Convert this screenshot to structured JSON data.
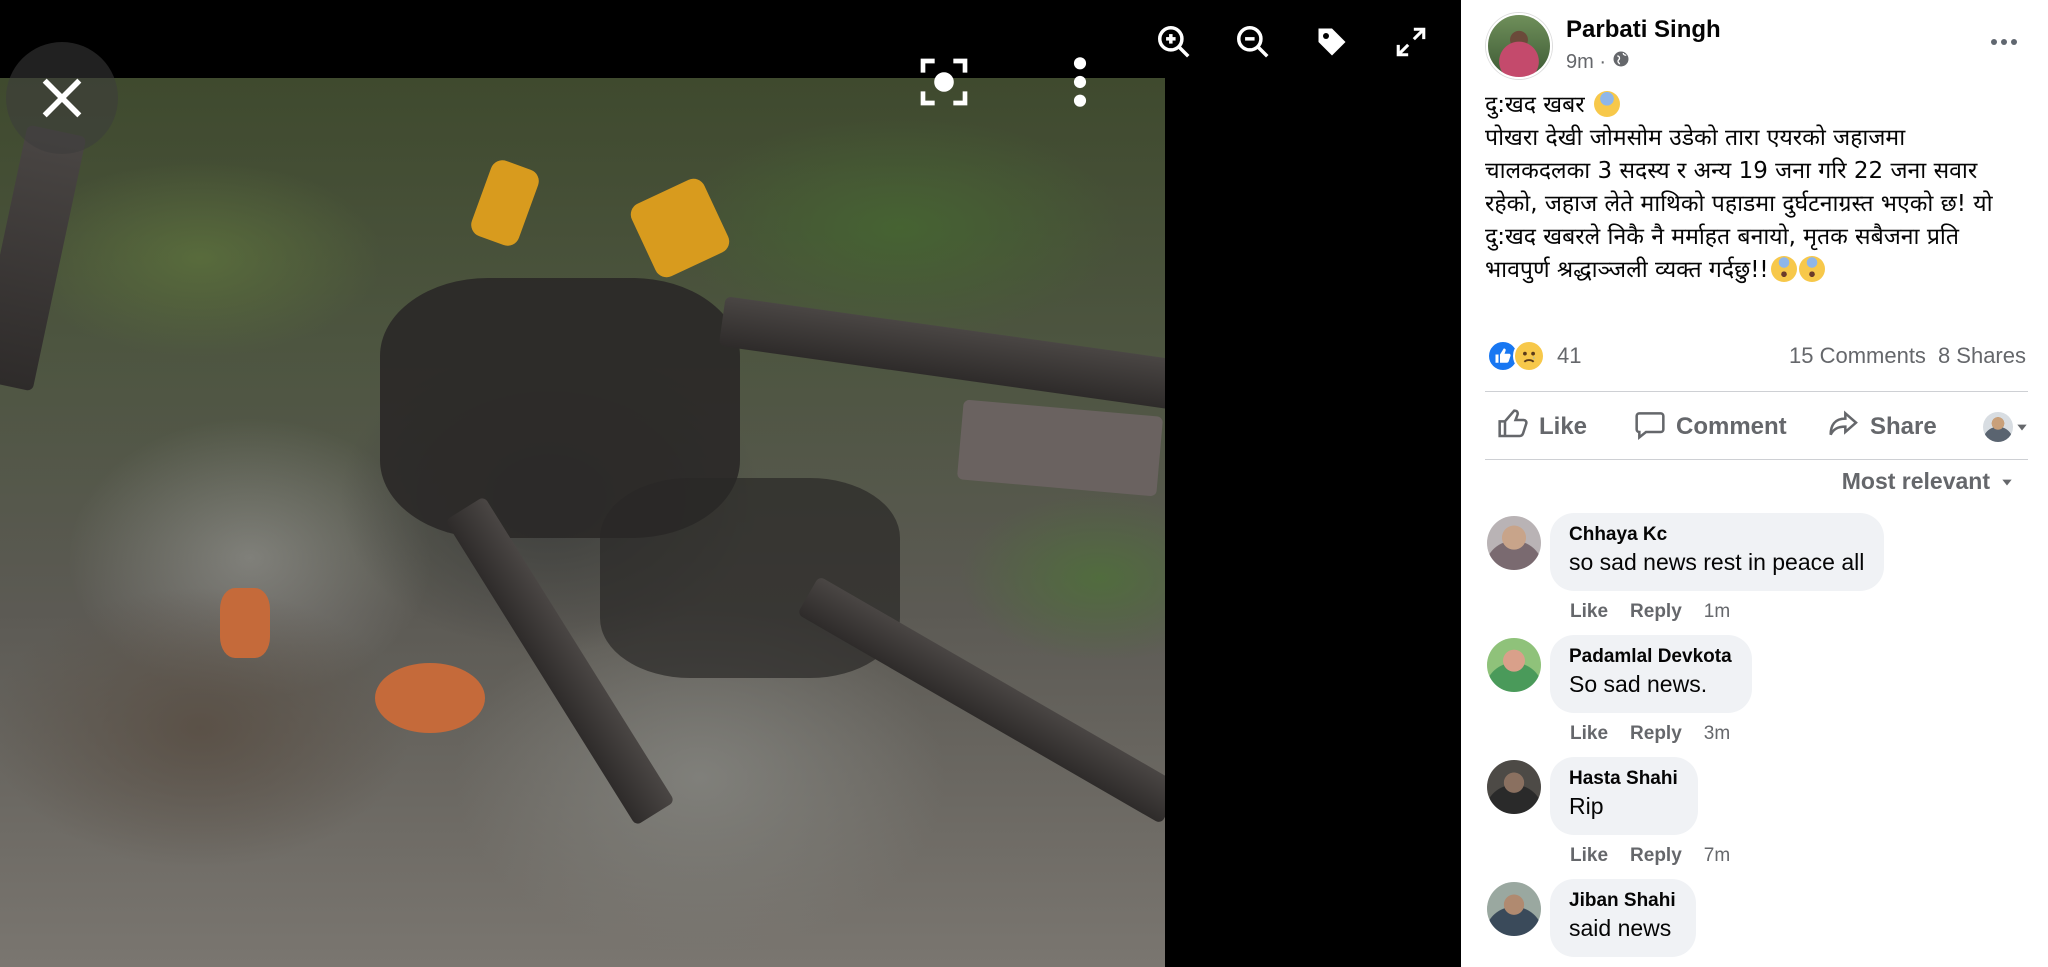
{
  "viewer": {
    "icons": [
      "zoom-in-icon",
      "zoom-out-icon",
      "tag-icon",
      "fullscreen-icon",
      "close-icon",
      "scan-icon",
      "more-vertical-icon"
    ]
  },
  "post": {
    "author": "Parbati Singh",
    "time": "9m ·",
    "lines": [
      "दु:खद खबर",
      "पोखरा देखी जोमसोम उडेको तारा एयरको जहाजमा",
      "चालकदलका 3 सदस्य र अन्य 19 जना गरि 22 जना सवार",
      "रहेको, जहाज लेते माथिको पहाडमा दुर्घटनाग्रस्त भएको छ! यो",
      "दु:खद खबरले निकै नै मर्माहत बनायो, मृतक सबैजना प्रति",
      "भावपुर्ण श्रद्धाञ्जली व्यक्त गर्दछु!!"
    ],
    "reaction_count": "41",
    "comments_count": "15 Comments",
    "shares_count": "8 Shares",
    "actions": {
      "like": "Like",
      "comment": "Comment",
      "share": "Share"
    },
    "sort_label": "Most relevant"
  },
  "comments": [
    {
      "name": "Chhaya Kc",
      "text": "so sad news rest in peace all",
      "like": "Like",
      "reply": "Reply",
      "time": "1m"
    },
    {
      "name": "Padamlal Devkota",
      "text": "So sad news.",
      "like": "Like",
      "reply": "Reply",
      "time": "3m"
    },
    {
      "name": "Hasta Shahi",
      "text": "Rip",
      "like": "Like",
      "reply": "Reply",
      "time": "7m"
    },
    {
      "name": "Jiban Shahi",
      "text": "said news"
    }
  ],
  "colors": {
    "accent": "#1877f2",
    "muted": "#65676b",
    "bubble": "#f0f2f5"
  }
}
